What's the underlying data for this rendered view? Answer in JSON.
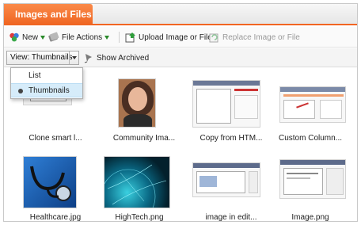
{
  "panel": {
    "title": "Images and Files"
  },
  "toolbar": {
    "new_label": "New",
    "file_actions_label": "File Actions",
    "upload_label": "Upload Image or File",
    "replace_label": "Replace Image or File"
  },
  "viewbar": {
    "view_label": "View: Thumbnails",
    "show_archived_label": "Show Archived"
  },
  "view_menu": {
    "options": [
      {
        "label": "List",
        "selected": false
      },
      {
        "label": "Thumbnails",
        "selected": true
      }
    ]
  },
  "files": [
    {
      "name": "Clone smart l...",
      "kind": "screenshot"
    },
    {
      "name": "Community Ima...",
      "kind": "portrait"
    },
    {
      "name": "Copy from HTM...",
      "kind": "screenshot"
    },
    {
      "name": "Custom Column...",
      "kind": "screenshot"
    },
    {
      "name": "Healthcare.jpg",
      "kind": "stethoscope"
    },
    {
      "name": "HighTech.png",
      "kind": "globe"
    },
    {
      "name": "image in edit...",
      "kind": "screenshot"
    },
    {
      "name": "Image.png",
      "kind": "screenshot"
    }
  ],
  "colors": {
    "accent": "#f26522",
    "selection": "#d6ecfa"
  }
}
